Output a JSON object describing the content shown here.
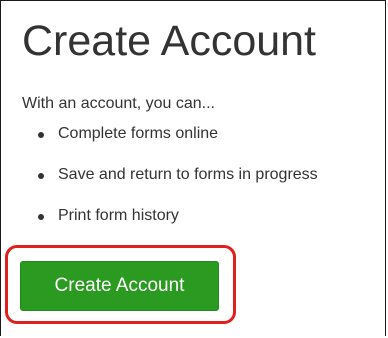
{
  "page": {
    "title": "Create Account",
    "intro": "With an account, you can...",
    "features": [
      "Complete forms online",
      "Save and return to forms in progress",
      "Print form history"
    ],
    "create_button_label": "Create Account"
  },
  "colors": {
    "text": "#333333",
    "button_green": "#2a9a20",
    "button_text": "#ffffff",
    "highlight_red": "#e0201f",
    "frame_border": "#1a1a1a"
  }
}
